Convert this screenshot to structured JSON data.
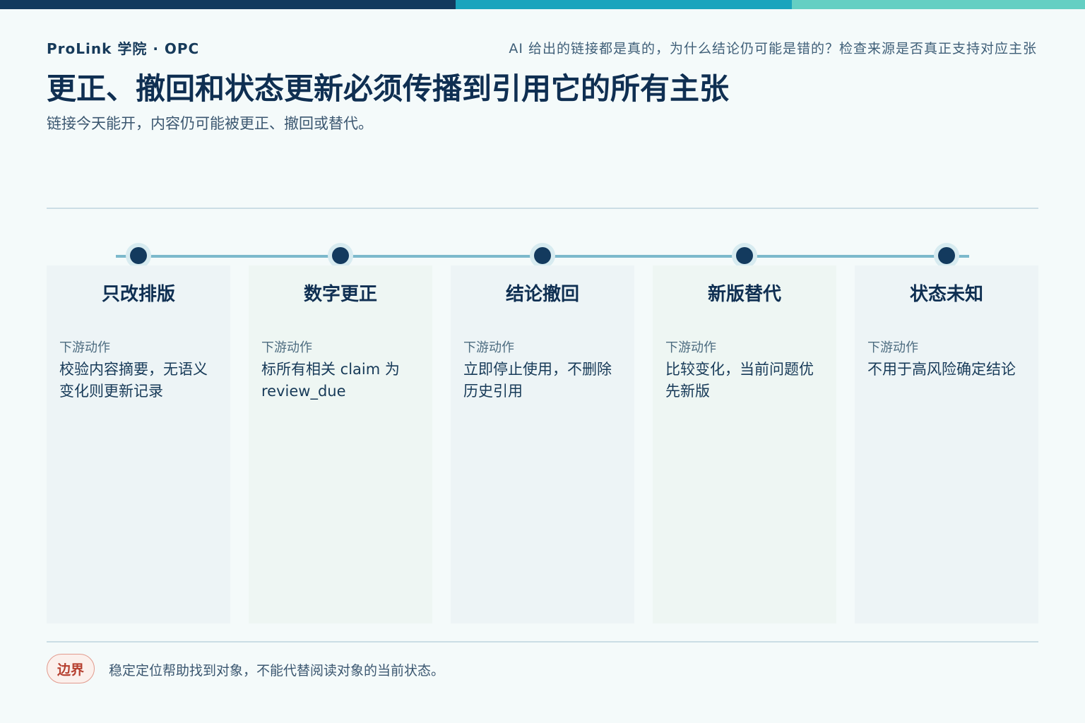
{
  "header": {
    "brand": "ProLink 学院 · OPC",
    "tagline": "AI 给出的链接都是真的，为什么结论仍可能是错的？检查来源是否真正支持对应主张",
    "title": "更正、撤回和状态更新必须传播到引用它的所有主张",
    "subtitle": "链接今天能开，内容仍可能被更正、撤回或替代。"
  },
  "colors": {
    "dark_navy": "#123a5e",
    "teal": "#1aa4bd",
    "mint": "#64cfc3",
    "alert_red": "#b64030"
  },
  "cards": [
    {
      "title": "只改排版",
      "label": "下游动作",
      "body": "校验内容摘要，无语义变化则更新记录"
    },
    {
      "title": "数字更正",
      "label": "下游动作",
      "body": "标所有相关 claim 为 review_due"
    },
    {
      "title": "结论撤回",
      "label": "下游动作",
      "body": "立即停止使用，不删除历史引用"
    },
    {
      "title": "新版替代",
      "label": "下游动作",
      "body": "比较变化，当前问题优先新版"
    },
    {
      "title": "状态未知",
      "label": "下游动作",
      "body": "不用于高风险确定结论"
    }
  ],
  "footer": {
    "badge": "边界",
    "note": "稳定定位帮助找到对象，不能代替阅读对象的当前状态。"
  }
}
